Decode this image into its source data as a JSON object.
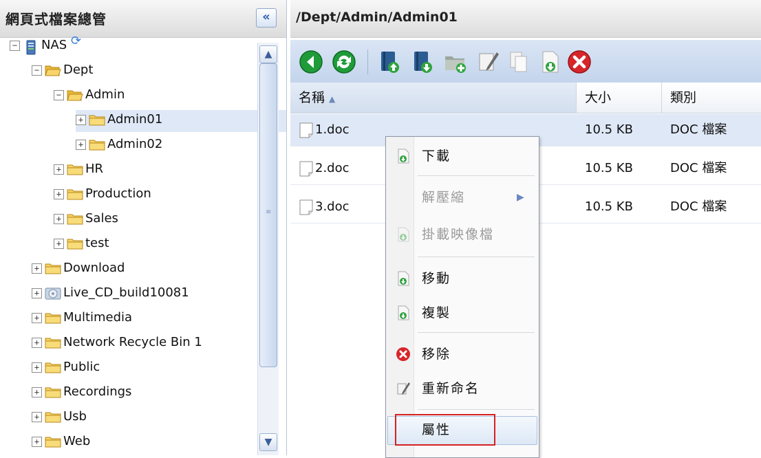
{
  "left_panel": {
    "title": "網頁式檔案總管",
    "collapse_glyph": "«",
    "tree": [
      {
        "label": "NAS",
        "depth": 0,
        "expander": "⊟",
        "icon": "server-icon"
      },
      {
        "label": "Dept",
        "depth": 1,
        "expander": "⊟",
        "icon": "folder-open-icon"
      },
      {
        "label": "Admin",
        "depth": 2,
        "expander": "⊟",
        "icon": "folder-open-icon"
      },
      {
        "label": "Admin01",
        "depth": 3,
        "expander": "⊞",
        "icon": "folder-icon",
        "selected": true
      },
      {
        "label": "Admin02",
        "depth": 3,
        "expander": "⊞",
        "icon": "folder-icon"
      },
      {
        "label": "HR",
        "depth": 2,
        "expander": "⊞",
        "icon": "folder-icon"
      },
      {
        "label": "Production",
        "depth": 2,
        "expander": "⊞",
        "icon": "folder-icon"
      },
      {
        "label": "Sales",
        "depth": 2,
        "expander": "⊞",
        "icon": "folder-icon"
      },
      {
        "label": "test",
        "depth": 2,
        "expander": "⊞",
        "icon": "folder-icon"
      },
      {
        "label": "Download",
        "depth": 1,
        "expander": "⊞",
        "icon": "folder-icon"
      },
      {
        "label": "Live_CD_build10081",
        "depth": 1,
        "expander": "⊞",
        "icon": "disc-folder-icon"
      },
      {
        "label": "Multimedia",
        "depth": 1,
        "expander": "⊞",
        "icon": "folder-icon"
      },
      {
        "label": "Network Recycle Bin 1",
        "depth": 1,
        "expander": "⊞",
        "icon": "folder-icon"
      },
      {
        "label": "Public",
        "depth": 1,
        "expander": "⊞",
        "icon": "folder-icon"
      },
      {
        "label": "Recordings",
        "depth": 1,
        "expander": "⊞",
        "icon": "folder-icon"
      },
      {
        "label": "Usb",
        "depth": 1,
        "expander": "⊞",
        "icon": "folder-icon"
      },
      {
        "label": "Web",
        "depth": 1,
        "expander": "⊞",
        "icon": "folder-icon"
      }
    ]
  },
  "right_panel": {
    "path": "/Dept/Admin/Admin01",
    "toolbar_icons": [
      "back-icon",
      "refresh-icon",
      "upload-icon",
      "download-icon",
      "new-folder-icon",
      "rename-icon",
      "copy-icon",
      "add-file-icon",
      "delete-icon"
    ],
    "columns": {
      "name": "名稱",
      "size": "大小",
      "type": "類別",
      "sort_glyph": "▲"
    },
    "files": [
      {
        "name": "1.doc",
        "size": "10.5 KB",
        "type": "DOC 檔案",
        "selected": true
      },
      {
        "name": "2.doc",
        "size": "10.5 KB",
        "type": "DOC 檔案"
      },
      {
        "name": "3.doc",
        "size": "10.5 KB",
        "type": "DOC 檔案"
      }
    ]
  },
  "context_menu": {
    "items": [
      {
        "label": "下載",
        "icon": "download-icon",
        "enabled": true
      },
      {
        "label": "解壓縮",
        "icon": "",
        "enabled": false,
        "submenu": true
      },
      {
        "label": "掛載映像檔",
        "icon": "mount-icon",
        "enabled": false
      },
      {
        "label": "移動",
        "icon": "move-icon",
        "enabled": true
      },
      {
        "label": "複製",
        "icon": "copy-icon",
        "enabled": true
      },
      {
        "label": "移除",
        "icon": "delete-icon",
        "enabled": true
      },
      {
        "label": "重新命名",
        "icon": "rename-icon",
        "enabled": true
      },
      {
        "label": "屬性",
        "icon": "",
        "enabled": true,
        "highlighted": true
      }
    ],
    "submenu_glyph": "▶"
  },
  "colors": {
    "selection": "#dfe8f6",
    "toolbar": "#c3d4ec",
    "highlight_box": "#d62020",
    "folder": "#f4cf52"
  }
}
